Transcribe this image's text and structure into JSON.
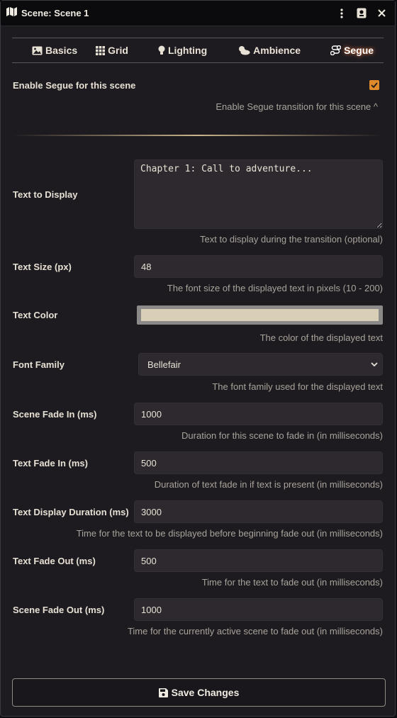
{
  "window": {
    "title": "Scene: Scene 1"
  },
  "tabs": [
    {
      "label": "Basics",
      "icon": "image-icon"
    },
    {
      "label": "Grid",
      "icon": "grid-icon"
    },
    {
      "label": "Lighting",
      "icon": "lightbulb-icon"
    },
    {
      "label": "Ambience",
      "icon": "cloud-sun-icon"
    },
    {
      "label": "Segue",
      "icon": "route-icon"
    }
  ],
  "active_tab": "Segue",
  "enable": {
    "label": "Enable Segue for this scene",
    "checked": true,
    "hint": "Enable Segue transition for this scene ^"
  },
  "fields": {
    "text": {
      "label": "Text to Display",
      "value": "Chapter 1: Call to adventure...",
      "hint": "Text to display during the transition (optional)"
    },
    "size": {
      "label": "Text Size (px)",
      "value": "48",
      "hint": "The font size of the displayed text in pixels (10 - 200)"
    },
    "color": {
      "label": "Text Color",
      "value": "#d8cfb6",
      "hint": "The color of the displayed text"
    },
    "font": {
      "label": "Font Family",
      "value": "Bellefair",
      "hint": "The font family used for the displayed text"
    },
    "scene_fade_in": {
      "label": "Scene Fade In (ms)",
      "value": "1000",
      "hint": "Duration for this scene to fade in (in milliseconds)"
    },
    "text_fade_in": {
      "label": "Text Fade In (ms)",
      "value": "500",
      "hint": "Duration of text fade in if text is present (in milliseconds)"
    },
    "display_duration": {
      "label": "Text Display Duration (ms)",
      "value": "3000",
      "hint": "Time for the text to be displayed before beginning fade out (in milliseconds)"
    },
    "text_fade_out": {
      "label": "Text Fade Out (ms)",
      "value": "500",
      "hint": "Time for the text to fade out (in milliseconds)"
    },
    "scene_fade_out": {
      "label": "Scene Fade Out (ms)",
      "value": "1000",
      "hint": "Time for the currently active scene to fade out (in milliseconds)"
    }
  },
  "save_button": {
    "label": "Save Changes"
  },
  "colors": {
    "accent": "#e08a2a",
    "background": "#1e1b20",
    "field": "#2d292e"
  }
}
